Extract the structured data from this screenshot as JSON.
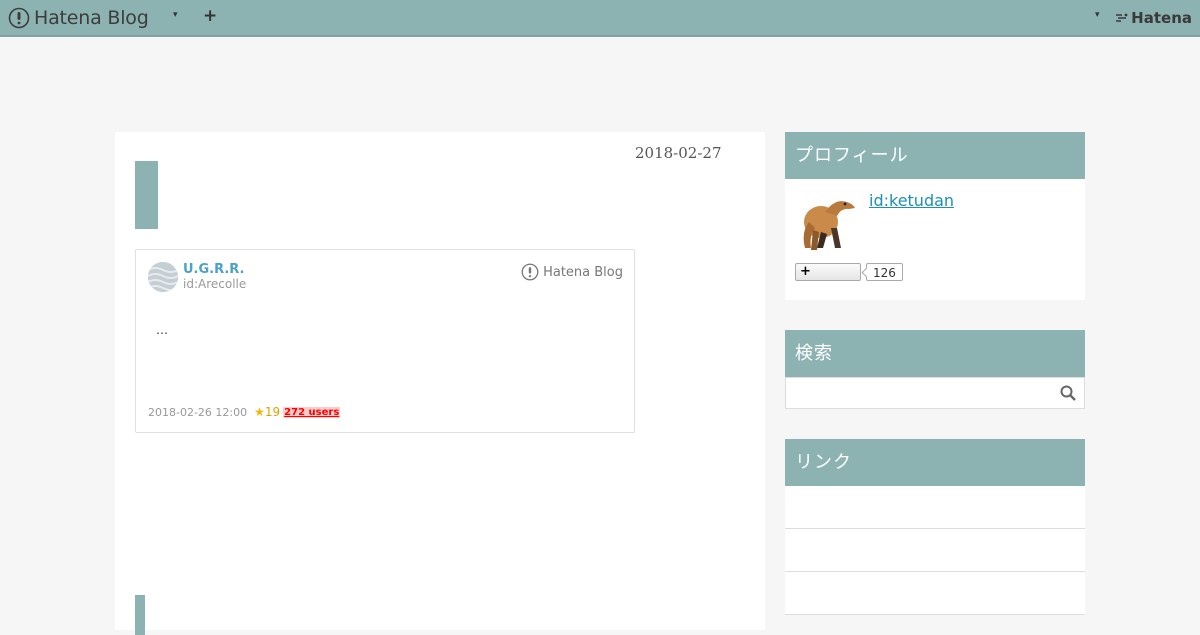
{
  "topbar": {
    "brand": "Hatena Blog",
    "caret": "▾",
    "add": "+",
    "user_caret": "▾",
    "hatena": "Hatena"
  },
  "entry": {
    "date": "2018-02-27",
    "embed": {
      "author_name": "U.G.R.R.",
      "author_id": "id:Arecolle",
      "service": "Hatena Blog",
      "excerpt": "…",
      "timestamp": "2018-02-26 12:00",
      "star_icon": "★",
      "stars": "19",
      "bookmark_users": "272 users"
    }
  },
  "sidebar": {
    "profile": {
      "title": "プロフィール",
      "id": "id:ketudan",
      "follow_label": "+",
      "follower_count": "126"
    },
    "search": {
      "title": "検索",
      "placeholder": ""
    },
    "links": {
      "title": "リンク",
      "items": [
        "",
        "",
        ""
      ]
    }
  },
  "colors": {
    "accent": "#8cb2b2",
    "link": "#1a8fb8",
    "author": "#4ba1c6",
    "bookmark": "#ff0000"
  }
}
